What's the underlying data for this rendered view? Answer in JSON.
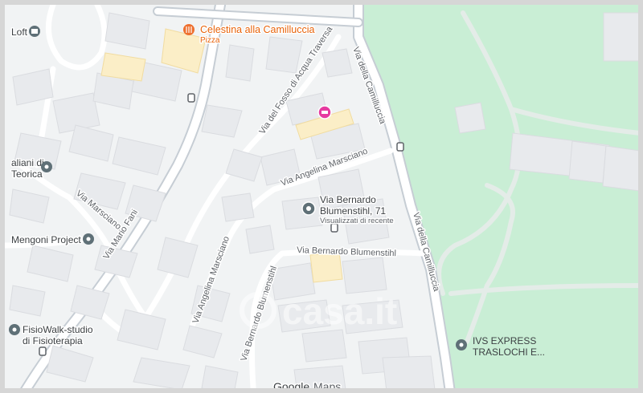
{
  "colors": {
    "land": "#f1f3f4",
    "park": "#c9eed5",
    "building": "#e8eaed",
    "building_stroke": "#dadce0",
    "highlight_building": "#fbeec7",
    "road": "#ffffff",
    "major_road": "#c6cdd4",
    "restaurant": "#ee6f2e",
    "hotel": "#e63ba0",
    "poi_gray": "#5f7077"
  },
  "roads": {
    "via_mario_fani": "Via Mario Fani",
    "via_del_fosso": "Via del Fosso di Acqua Traversa",
    "via_della_camilluccia_top": "Via della Camilluccia",
    "via_della_camilluccia_bottom": "Via della Camilluccia",
    "via_angelina_marsciano_upper": "Via Angelina Marsciano",
    "via_angelina_marsciano_lower": "Via Angelina Marsciano",
    "via_marsciano": "Via Marsciano",
    "via_bernardo_blumenstihl": "Via Bernardo Blumenstihl",
    "via_bernardo_blumenstihl_vertical": "Via Bernardo Blumenstihl"
  },
  "pois": {
    "restaurant": {
      "name": "Celestina alla Camilluccia",
      "category": "Pizza",
      "icon": "restaurant-icon"
    },
    "loft": {
      "name": "Loft",
      "icon": "shop-icon"
    },
    "teorica": {
      "line1": "aliani di",
      "line2": "Teorica",
      "icon": "place-icon"
    },
    "mengoni": {
      "name": "Mengoni Project",
      "icon": "place-icon"
    },
    "fisiowalk": {
      "line1": "FisioWalk-studio",
      "line2": "di Fisioterapia",
      "icon": "place-icon"
    },
    "ivs": {
      "line1": "IVS EXPRESS",
      "line2": "TRASLOCHI E...",
      "icon": "place-icon"
    }
  },
  "selected_place": {
    "line1": "Via Bernardo",
    "line2": "Blumenstihl, 71",
    "note": "Visualizzati di recente",
    "icon": "place-pin-icon"
  },
  "hotel_marker": {
    "icon": "hotel-icon"
  },
  "bus_stops": {
    "icon": "bus-stop-icon"
  },
  "watermark": "casa.it",
  "attribution": {
    "google": "Google",
    "maps": "Maps"
  }
}
